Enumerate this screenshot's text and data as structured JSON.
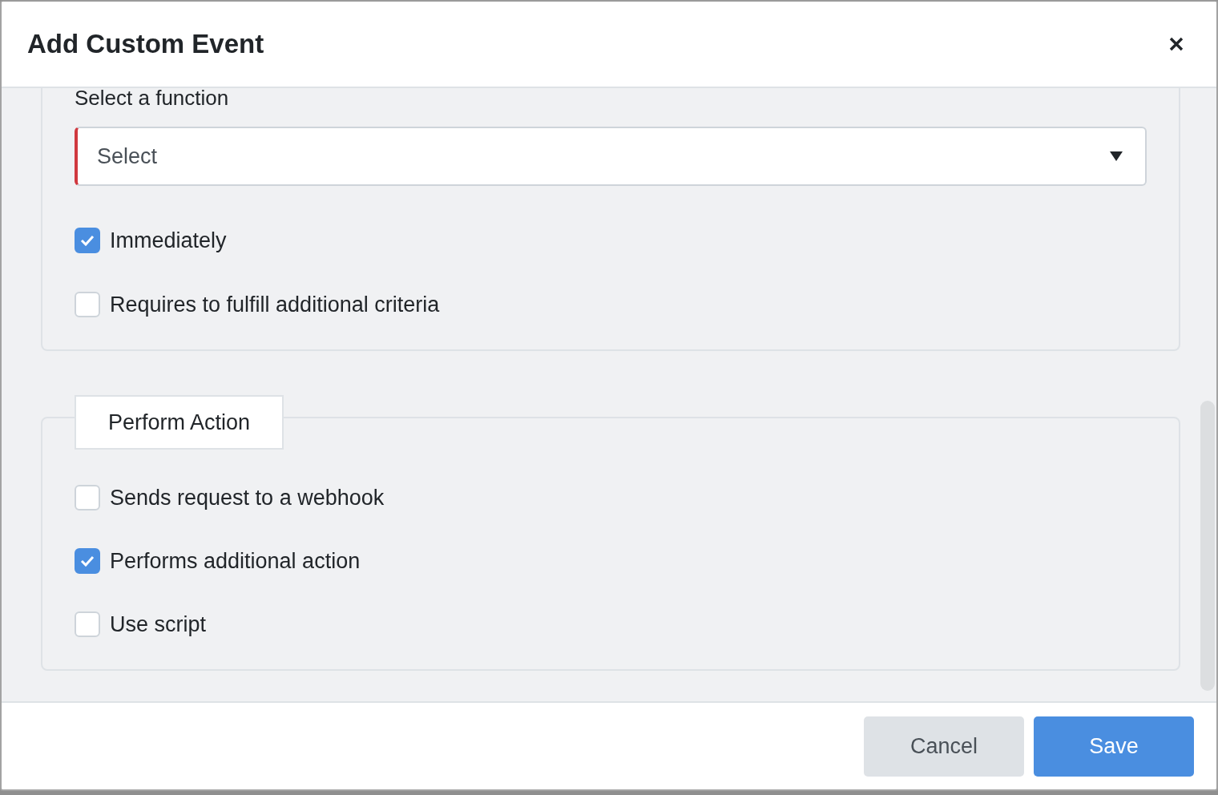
{
  "dialog": {
    "title": "Add Custom Event"
  },
  "sections": [
    {
      "field": {
        "label": "Select a function",
        "placeholder": "Select",
        "invalid": true
      },
      "options": [
        {
          "label": "Immediately",
          "checked": true
        },
        {
          "label": "Requires to fulfill additional criteria",
          "checked": false
        }
      ]
    },
    {
      "legend": "Perform Action",
      "options": [
        {
          "label": "Sends request to a webhook",
          "checked": false
        },
        {
          "label": "Performs additional action",
          "checked": true
        },
        {
          "label": "Use script",
          "checked": false
        }
      ]
    }
  ],
  "buttons": [
    {
      "label": "Cancel",
      "kind": "secondary"
    },
    {
      "label": "Save",
      "kind": "primary"
    }
  ]
}
